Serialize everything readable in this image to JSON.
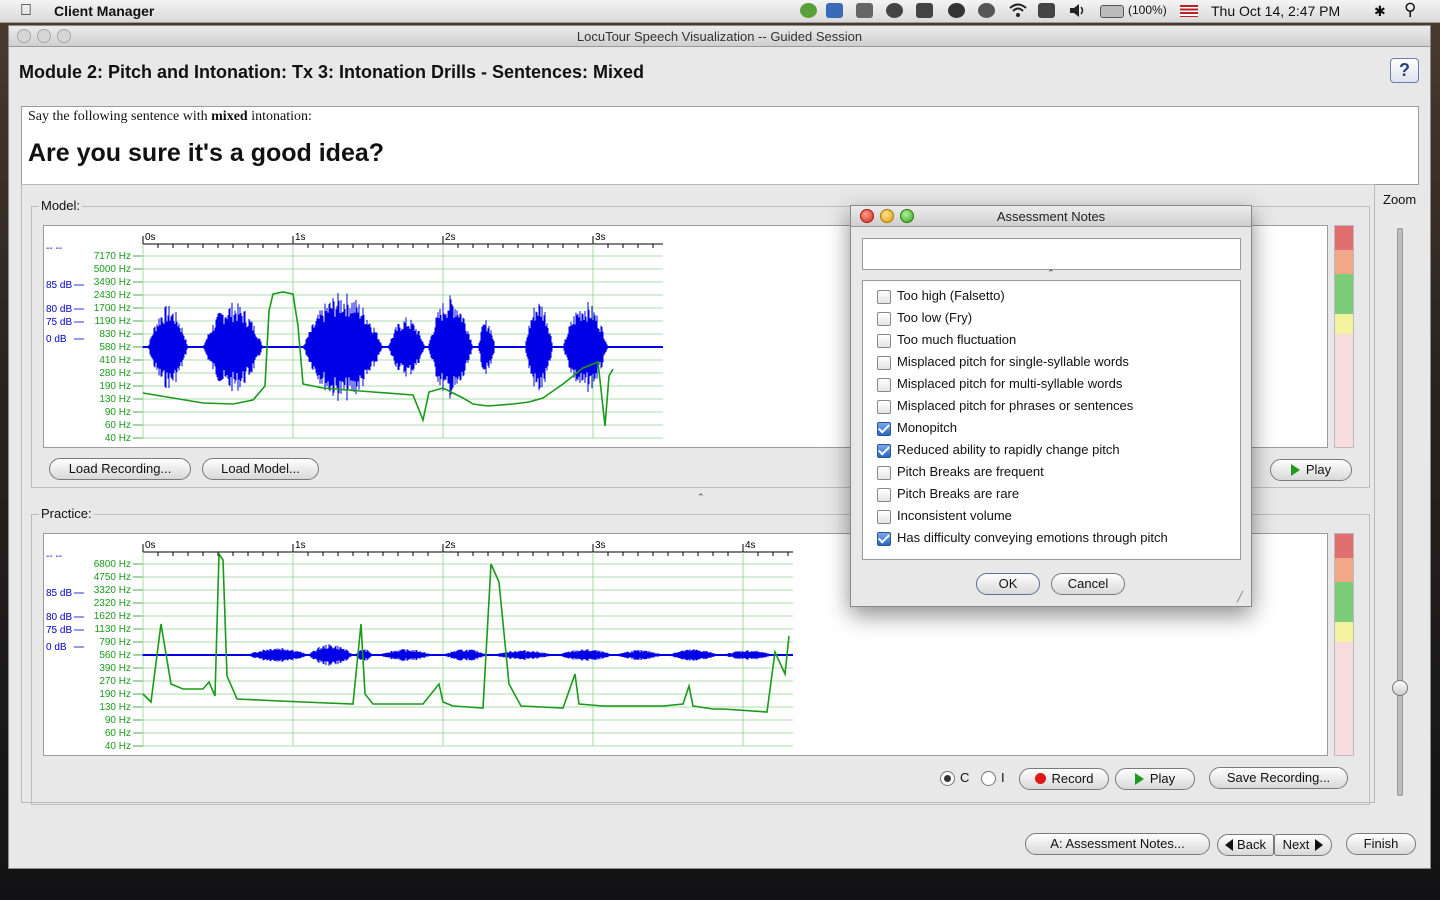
{
  "menubar": {
    "app_name": "Client Manager",
    "battery": "(100%)",
    "clock": "Thu Oct 14,  2:47 PM"
  },
  "window": {
    "title": "LocuTour Speech Visualization -- Guided Session",
    "module_title": "Module 2: Pitch and Intonation: Tx 3: Intonation Drills - Sentences: Mixed",
    "help_label": "?"
  },
  "prompt": {
    "instruction_pre": "Say the following sentence with ",
    "instruction_bold": "mixed",
    "instruction_post": " intonation:",
    "sentence": "Are you sure it's a good idea?"
  },
  "zoom_label": "Zoom",
  "model": {
    "label": "Model:",
    "time_ticks": [
      "0s",
      "1s",
      "2s",
      "3s"
    ],
    "hz_ticks": [
      "7170 Hz",
      "5000 Hz",
      "3490 Hz",
      "2430 Hz",
      "1700 Hz",
      "1190 Hz",
      "830 Hz",
      "580 Hz",
      "410 Hz",
      "280 Hz",
      "190 Hz",
      "130 Hz",
      "90 Hz",
      "60 Hz",
      "40 Hz"
    ],
    "db_ticks": [
      "85 dB",
      "80 dB",
      "75 dB",
      "0 dB"
    ],
    "load_recording": "Load Recording...",
    "load_model": "Load Model...",
    "play": "Play"
  },
  "practice": {
    "label": "Practice:",
    "time_ticks": [
      "0s",
      "1s",
      "2s",
      "3s",
      "4s"
    ],
    "hz_ticks": [
      "6800 Hz",
      "4750 Hz",
      "3320 Hz",
      "2320 Hz",
      "1620 Hz",
      "1130 Hz",
      "790 Hz",
      "560 Hz",
      "390 Hz",
      "270 Hz",
      "190 Hz",
      "130 Hz",
      "90 Hz",
      "60 Hz",
      "40 Hz"
    ],
    "db_ticks": [
      "85 dB",
      "80 dB",
      "75 dB",
      "0 dB"
    ],
    "radio_c": "C",
    "radio_i": "I",
    "record": "Record",
    "play": "Play",
    "save_recording": "Save Recording..."
  },
  "footer": {
    "assessment_notes": "A: Assessment Notes...",
    "back": "Back",
    "next": "Next",
    "finish": "Finish"
  },
  "dialog": {
    "title": "Assessment Notes",
    "text_value": "",
    "items": [
      {
        "label": "Too high (Falsetto)",
        "checked": false
      },
      {
        "label": "Too low (Fry)",
        "checked": false
      },
      {
        "label": "Too much fluctuation",
        "checked": false
      },
      {
        "label": "Misplaced pitch for single-syllable words",
        "checked": false
      },
      {
        "label": "Misplaced pitch for multi-syllable words",
        "checked": false
      },
      {
        "label": "Misplaced pitch for phrases or sentences",
        "checked": false
      },
      {
        "label": "Monopitch",
        "checked": true
      },
      {
        "label": "Reduced ability to rapidly change pitch",
        "checked": true
      },
      {
        "label": "Pitch Breaks are frequent",
        "checked": false
      },
      {
        "label": "Pitch Breaks are rare",
        "checked": false
      },
      {
        "label": "Inconsistent volume",
        "checked": false
      },
      {
        "label": "Has difficulty conveying emotions through pitch",
        "checked": true
      }
    ],
    "ok": "OK",
    "cancel": "Cancel"
  },
  "colors": {
    "waveform": "#0000e6",
    "pitch": "#1a9a1a",
    "meter_red": "#e07070",
    "meter_orange": "#f0a888",
    "meter_green": "#7ccc7c",
    "meter_yellow": "#f4f4a0",
    "meter_pink": "#f6dcdc"
  }
}
